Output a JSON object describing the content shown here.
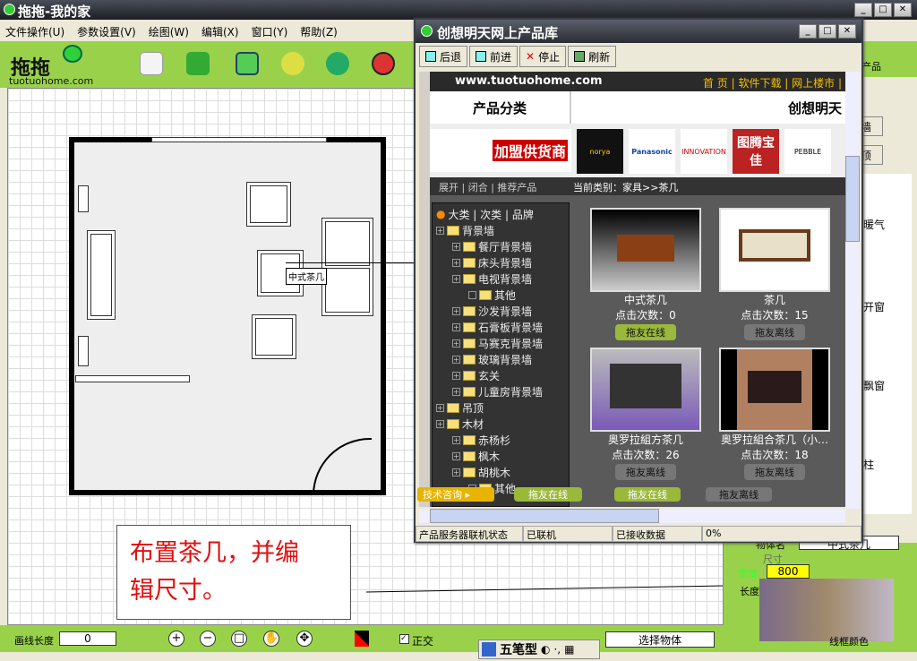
{
  "app": {
    "title": "拖拖-我的家"
  },
  "menu": [
    "文件操作(U)",
    "参数设置(V)",
    "绘图(W)",
    "编辑(X)",
    "窗口(Y)",
    "帮助(Z)"
  ],
  "logo": {
    "text": "拖拖",
    "url": "tuotuohome.com"
  },
  "toolbar_icons": [
    "new-icon",
    "book-icon",
    "save-icon",
    "pointer-icon",
    "refresh-icon",
    "close-icon"
  ],
  "canvas": {
    "tooltip": "中式茶几"
  },
  "note": {
    "line1": "布置茶几，并编",
    "line2": "辑尺寸。"
  },
  "popup": {
    "title": "创想明天网上产品库",
    "buttons": [
      "后退",
      "前进",
      "停止",
      "刷新"
    ],
    "site": {
      "url": "www.tuotuohome.com",
      "nav": "首 页 | 软件下载 | 网上楼市 |",
      "left_head": "产品分类",
      "right_head": "创想明天",
      "join": "加盟供货商",
      "brands": [
        "norya",
        "Panasonic",
        "INNOVATION",
        "图腾宝佳",
        "PEBBLE"
      ]
    },
    "cat_links": "展开 | 闭合 | 推荐产品",
    "current": "当前类别：家具>>茶几",
    "tree_head": "大类 | 次类 | 品牌",
    "tree": [
      {
        "l": 0,
        "t": "背景墙"
      },
      {
        "l": 1,
        "t": "餐厅背景墙"
      },
      {
        "l": 1,
        "t": "床头背景墙"
      },
      {
        "l": 1,
        "t": "电视背景墙"
      },
      {
        "l": 2,
        "t": "其他"
      },
      {
        "l": 1,
        "t": "沙发背景墙"
      },
      {
        "l": 1,
        "t": "石膏板背景墙"
      },
      {
        "l": 1,
        "t": "马赛克背景墙"
      },
      {
        "l": 1,
        "t": "玻璃背景墙"
      },
      {
        "l": 1,
        "t": "玄关"
      },
      {
        "l": 1,
        "t": "儿童房背景墙"
      },
      {
        "l": 0,
        "t": "吊顶"
      },
      {
        "l": 0,
        "t": "木材"
      },
      {
        "l": 1,
        "t": "赤杨杉"
      },
      {
        "l": 1,
        "t": "枫木"
      },
      {
        "l": 1,
        "t": "胡桃木"
      },
      {
        "l": 2,
        "t": "其他"
      }
    ],
    "products": [
      {
        "name": "中式茶几",
        "clicks": "点击次数：0",
        "btn": "拖友在线",
        "online": true
      },
      {
        "name": "茶几",
        "clicks": "点击次数：15",
        "btn": "拖友离线",
        "online": false
      },
      {
        "name": "奥罗拉組方茶几",
        "clicks": "点击次数：26",
        "btn": "拖友离线",
        "online": false
      },
      {
        "name": "奥罗拉組合茶几（小…",
        "clicks": "点击次数：18",
        "btn": "拖友离线",
        "online": false
      }
    ],
    "chat": {
      "consult": "技术咨询 ▸",
      "b1": "拖友在线",
      "b2": "拖友在线",
      "b3": "拖友离线"
    },
    "status": [
      "产品服务器联机状态",
      "已联机",
      "已接收数据",
      "0%"
    ]
  },
  "right": {
    "header": "产品",
    "btn1": "墙",
    "btn2": "顶",
    "items": [
      "暖气",
      "开窗",
      "飘窗",
      "柱"
    ],
    "name_label": "物体名",
    "name_value": "中式茶几",
    "size_label": "尺寸",
    "width_label": "宽度",
    "width_value": "800",
    "length_label": "长度",
    "frame_color": "线框颜色"
  },
  "bottom": {
    "line_len_label": "画线长度",
    "line_len": "0",
    "ortho": "正交",
    "ime": "五笔型",
    "mode": "选择物体"
  }
}
